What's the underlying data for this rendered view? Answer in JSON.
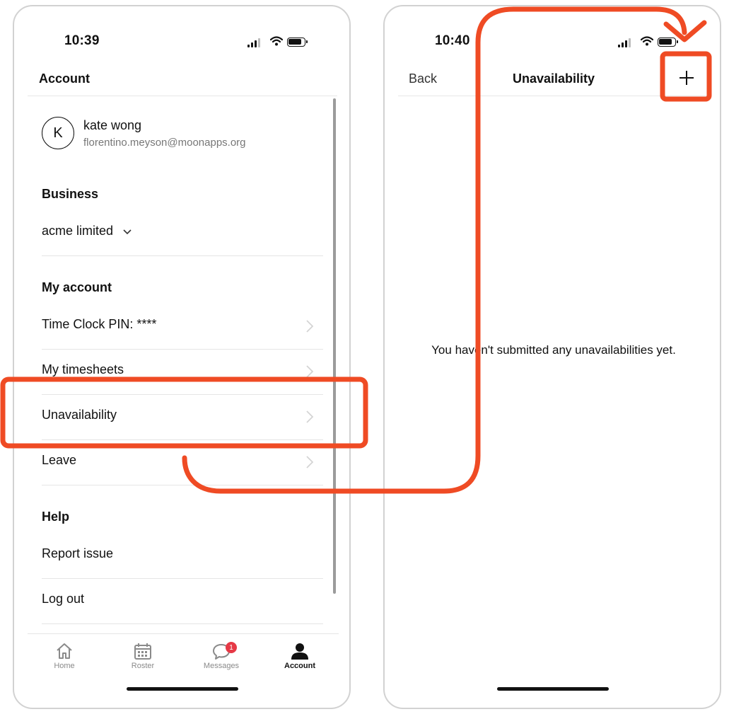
{
  "left_screen": {
    "status_time": "10:39",
    "title": "Account",
    "user": {
      "initial": "K",
      "name": "kate wong",
      "email": "florentino.meyson@moonapps.org"
    },
    "business": {
      "heading": "Business",
      "value": "acme limited"
    },
    "my_account": {
      "heading": "My account",
      "items": [
        {
          "label": "Time Clock PIN: ****"
        },
        {
          "label": "My timesheets"
        },
        {
          "label": "Unavailability"
        },
        {
          "label": "Leave"
        }
      ]
    },
    "help": {
      "heading": "Help",
      "items": [
        {
          "label": "Report issue"
        },
        {
          "label": "Log out"
        }
      ]
    },
    "tabs": [
      {
        "label": "Home",
        "icon": "home-icon"
      },
      {
        "label": "Roster",
        "icon": "calendar-icon"
      },
      {
        "label": "Messages",
        "icon": "chat-icon",
        "badge": "1"
      },
      {
        "label": "Account",
        "icon": "person-icon",
        "active": true
      }
    ]
  },
  "right_screen": {
    "status_time": "10:40",
    "back_label": "Back",
    "title": "Unavailability",
    "add_icon": "plus-icon",
    "empty_message": "You haven't submitted any unavailabilities yet."
  },
  "colors": {
    "annotation": "#ef4b24",
    "badge": "#e63946",
    "text": "#111111",
    "muted": "#777777"
  }
}
